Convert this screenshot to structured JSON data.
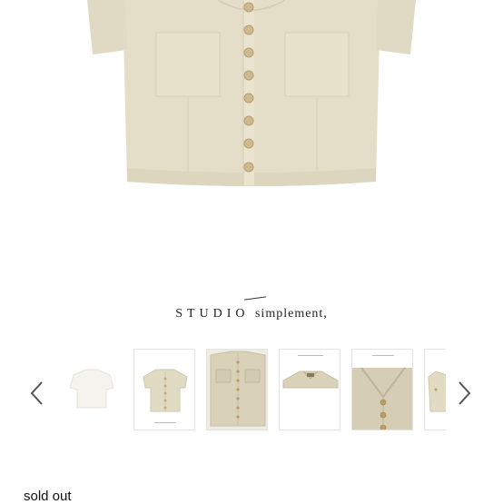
{
  "brand": {
    "studio": "STUDIO",
    "rest": "simplement,"
  },
  "status": "sold out",
  "icons": {
    "prev": "chevron-left-icon",
    "next": "chevron-right-icon"
  },
  "colors": {
    "garment": "#e4dec8",
    "button": "#cfb98f",
    "arrow": "#555555"
  },
  "gallery": {
    "thumbnails": [
      {
        "name": "thumbnail-ivory-top"
      },
      {
        "name": "thumbnail-beige-front"
      },
      {
        "name": "thumbnail-flat-lay"
      },
      {
        "name": "thumbnail-collar-closeup"
      },
      {
        "name": "thumbnail-button-closeup"
      },
      {
        "name": "thumbnail-side-view"
      }
    ]
  }
}
